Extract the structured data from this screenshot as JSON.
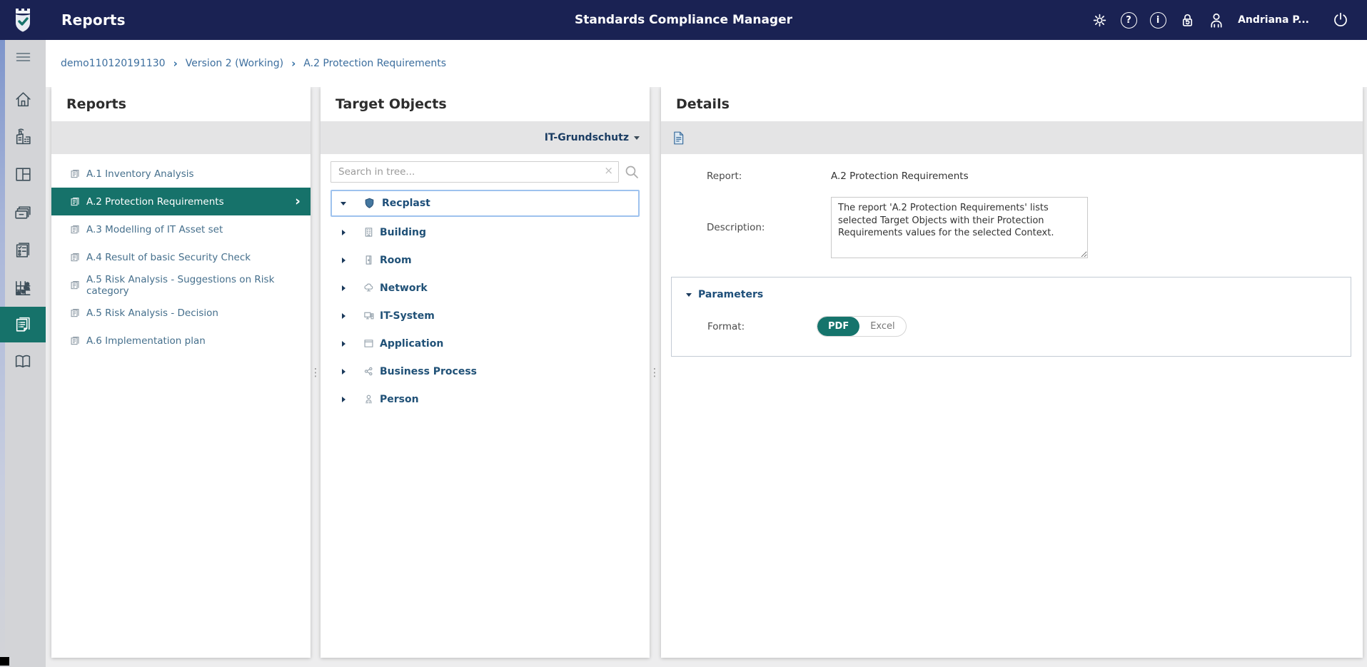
{
  "colors": {
    "accent_teal": "#16726A",
    "topbar_navy": "#1A2253",
    "link_blue": "#3C6E9E"
  },
  "topbar": {
    "page_title": "Reports",
    "app_title": "Standards Compliance Manager",
    "user_name": "Andriana P...",
    "icons": [
      "settings-icon",
      "help-icon",
      "info-icon",
      "session-lock-icon",
      "user-icon",
      "power-icon"
    ]
  },
  "breadcrumb": {
    "items": [
      "demo110120191130",
      "Version 2 (Working)",
      "A.2 Protection Requirements"
    ]
  },
  "sidebar": {
    "items": [
      {
        "icon": "menu-icon",
        "active": false
      },
      {
        "icon": "home-icon",
        "active": false
      },
      {
        "icon": "organization-icon",
        "active": false
      },
      {
        "icon": "dashboard-icon",
        "active": false
      },
      {
        "icon": "asset-archive-icon",
        "active": false
      },
      {
        "icon": "checklist-icon",
        "active": false
      },
      {
        "icon": "risk-matrix-icon",
        "active": false
      },
      {
        "icon": "reports-icon",
        "active": true
      },
      {
        "icon": "documentation-icon",
        "active": false
      }
    ]
  },
  "reports_panel": {
    "title": "Reports",
    "items": [
      {
        "label": "A.1 Inventory Analysis",
        "selected": false
      },
      {
        "label": "A.2 Protection Requirements",
        "selected": true
      },
      {
        "label": "A.3 Modelling of IT Asset set",
        "selected": false
      },
      {
        "label": "A.4 Result of basic Security Check",
        "selected": false
      },
      {
        "label": "A.5 Risk Analysis - Suggestions on Risk category",
        "selected": false
      },
      {
        "label": "A.5 Risk Analysis - Decision",
        "selected": false
      },
      {
        "label": "A.6 Implementation plan",
        "selected": false
      }
    ]
  },
  "target_objects_panel": {
    "title": "Target Objects",
    "context_selector": "IT-Grundschutz",
    "search_placeholder": "Search in tree...",
    "tree_root": {
      "label": "Recplast",
      "icon": "shield-icon",
      "expanded": true,
      "selected": true
    },
    "tree_children": [
      {
        "label": "Building",
        "icon": "building-icon"
      },
      {
        "label": "Room",
        "icon": "room-icon"
      },
      {
        "label": "Network",
        "icon": "network-icon"
      },
      {
        "label": "IT-System",
        "icon": "it-system-icon"
      },
      {
        "label": "Application",
        "icon": "application-icon"
      },
      {
        "label": "Business Process",
        "icon": "business-process-icon"
      },
      {
        "label": "Person",
        "icon": "person-icon"
      }
    ]
  },
  "details_panel": {
    "title": "Details",
    "report_label": "Report:",
    "report_value": "A.2 Protection Requirements",
    "description_label": "Description:",
    "description_value": "The report 'A.2 Protection Requirements' lists selected Target Objects with their Protection Requirements values for the selected Context.",
    "parameters": {
      "title": "Parameters",
      "format_label": "Format:",
      "format_options": [
        {
          "label": "PDF",
          "selected": true
        },
        {
          "label": "Excel",
          "selected": false
        }
      ]
    }
  }
}
